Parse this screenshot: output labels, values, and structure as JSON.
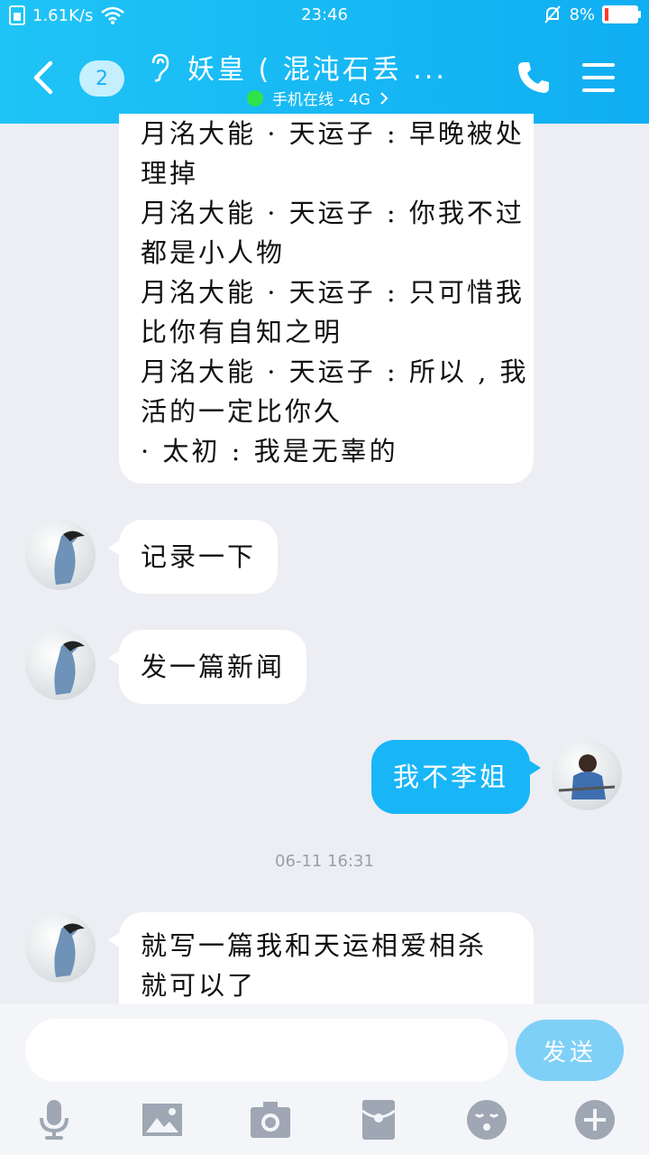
{
  "status_bar": {
    "network_speed": "1.61K/s",
    "time": "23:46",
    "battery": "8%"
  },
  "header": {
    "unread_count": "2",
    "title": "妖皇 ( 混沌石丢 ...",
    "online_status": "手机在线 - 4G"
  },
  "messages": {
    "quoted_lines": [
      "月洺大能 · 天运子 : 早晚被处",
      "理掉",
      "月洺大能 · 天运子 : 你我不过",
      "都是小人物",
      "月洺大能 · 天运子 : 只可惜我",
      "比你有自知之明",
      "月洺大能 · 天运子 : 所以 , 我",
      "活的一定比你久",
      "· 太初 : 我是无辜的"
    ],
    "msg1": "记录一下",
    "msg2": "发一篇新闻",
    "msg3": "我不李姐",
    "timestamp": "06-11 16:31",
    "msg4_line1": "就写一篇我和天运相爱相杀",
    "msg4_line2": "就可以了"
  },
  "input": {
    "placeholder": "",
    "send_label": "发送"
  },
  "colors": {
    "header_gradient_start": "#1fc4f6",
    "header_gradient_end": "#10aef2",
    "outgoing_bubble": "#19b6f7",
    "send_button": "#7fd0f7",
    "online_dot": "#2ee24a",
    "battery_low": "#ff3b30"
  },
  "icons": [
    "back-icon",
    "ear-icon",
    "phone-icon",
    "menu-icon",
    "mic-icon",
    "image-icon",
    "camera-icon",
    "red-packet-icon",
    "emoji-icon",
    "plus-icon"
  ]
}
